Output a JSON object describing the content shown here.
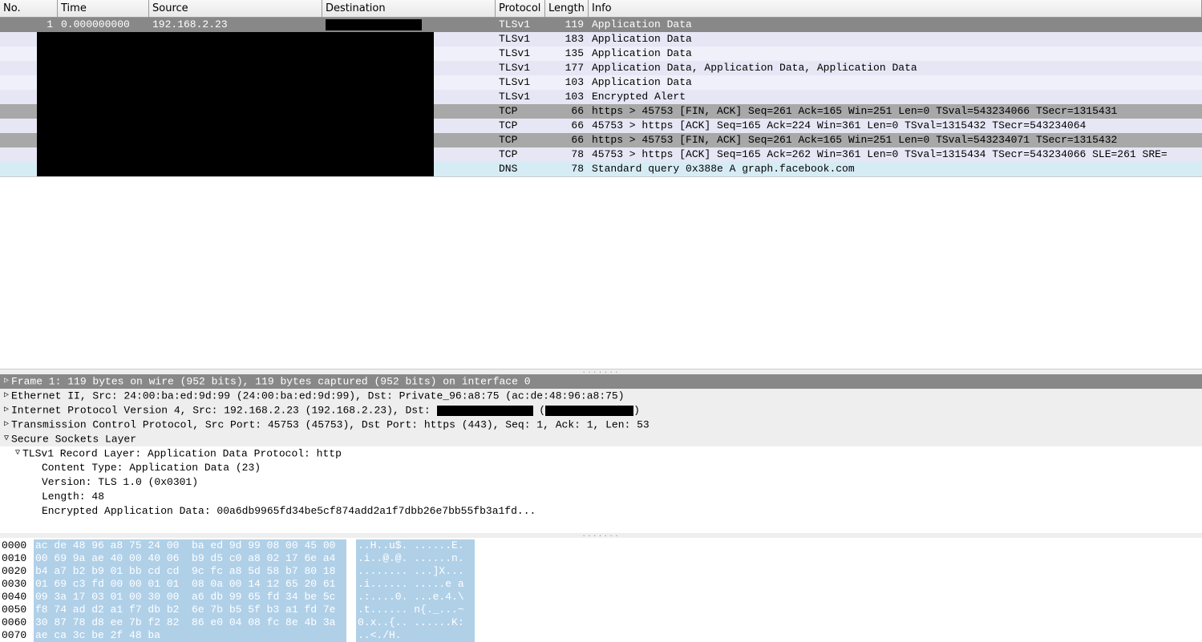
{
  "columns": {
    "no": "No.",
    "time": "Time",
    "src": "Source",
    "dst": "Destination",
    "proto": "Protocol",
    "len": "Length",
    "info": "Info"
  },
  "packets": [
    {
      "no": "1",
      "time": "0.000000000",
      "src": "192.168.2.23",
      "dst": "",
      "proto": "TLSv1",
      "len": "119",
      "info": "Application Data",
      "cls": "row-selected",
      "dstRedacted": true
    },
    {
      "no": "",
      "time": "",
      "src": "",
      "dst": "",
      "proto": "TLSv1",
      "len": "183",
      "info": "Application Data",
      "cls": "row-tls-odd"
    },
    {
      "no": "",
      "time": "",
      "src": "",
      "dst": "",
      "proto": "TLSv1",
      "len": "135",
      "info": "Application Data",
      "cls": "row-tls-even"
    },
    {
      "no": "",
      "time": "",
      "src": "",
      "dst": "",
      "proto": "TLSv1",
      "len": "177",
      "info": "Application Data, Application Data, Application Data",
      "cls": "row-tls-odd"
    },
    {
      "no": "",
      "time": "",
      "src": "",
      "dst": "",
      "proto": "TLSv1",
      "len": "103",
      "info": "Application Data",
      "cls": "row-tls-even"
    },
    {
      "no": "",
      "time": "",
      "src": "",
      "dst": "",
      "proto": "TLSv1",
      "len": "103",
      "info": "Encrypted Alert",
      "cls": "row-tls-odd"
    },
    {
      "no": "",
      "time": "",
      "src": "",
      "dst": "",
      "proto": "TCP",
      "len": "66",
      "info": "https > 45753 [FIN, ACK] Seq=261 Ack=165 Win=251 Len=0 TSval=543234066 TSecr=1315431",
      "cls": "row-tcp-gray"
    },
    {
      "no": "",
      "time": "",
      "src": "",
      "dst": "",
      "proto": "TCP",
      "len": "66",
      "info": "45753 > https [ACK] Seq=165 Ack=224 Win=361 Len=0 TSval=1315432 TSecr=543234064",
      "cls": "row-tcp-light"
    },
    {
      "no": "",
      "time": "",
      "src": "",
      "dst": "",
      "proto": "TCP",
      "len": "66",
      "info": "https > 45753 [FIN, ACK] Seq=261 Ack=165 Win=251 Len=0 TSval=543234071 TSecr=1315432",
      "cls": "row-tcp-gray"
    },
    {
      "no": "",
      "time": "",
      "src": "",
      "dst": "",
      "proto": "TCP",
      "len": "78",
      "info": "45753 > https [ACK] Seq=165 Ack=262 Win=361 Len=0 TSval=1315434 TSecr=543234066 SLE=261 SRE=",
      "cls": "row-tcp-light"
    },
    {
      "no": "",
      "time": "",
      "src": "",
      "dst": "",
      "proto": "DNS",
      "len": "78",
      "info": "Standard query 0x388e  A graph.facebook.com",
      "cls": "row-dns"
    }
  ],
  "details": {
    "frame": "Frame 1: 119 bytes on wire (952 bits), 119 bytes captured (952 bits) on interface 0",
    "eth": "Ethernet II, Src: 24:00:ba:ed:9d:99 (24:00:ba:ed:9d:99), Dst: Private_96:a8:75 (ac:de:48:96:a8:75)",
    "ip_a": "Internet Protocol Version 4, Src: 192.168.2.23 (192.168.2.23), Dst: ",
    "ip_b": " (",
    "ip_c": ")",
    "tcp": "Transmission Control Protocol, Src Port: 45753 (45753), Dst Port: https (443), Seq: 1, Ack: 1, Len: 53",
    "ssl": "Secure Sockets Layer",
    "tlsrec": "TLSv1 Record Layer: Application Data Protocol: http",
    "ctype": "Content Type: Application Data (23)",
    "ver": "Version: TLS 1.0 (0x0301)",
    "lenf": "Length: 48",
    "encd": "Encrypted Application Data: 00a6db9965fd34be5cf874add2a1f7dbb26e7bb55fb3a1fd..."
  },
  "hex": [
    {
      "off": "0000",
      "b": "ac de 48 96 a8 75 24 00  ba ed 9d 99 08 00 45 00",
      "a": "..H..u$. ......E."
    },
    {
      "off": "0010",
      "b": "00 69 9a ae 40 00 40 06  b9 d5 c0 a8 02 17 6e a4",
      "a": ".i..@.@. ......n."
    },
    {
      "off": "0020",
      "b": "b4 a7 b2 b9 01 bb cd cd  9c fc a8 5d 58 b7 80 18",
      "a": "........ ...]X..."
    },
    {
      "off": "0030",
      "b": "01 69 c3 fd 00 00 01 01  08 0a 00 14 12 65 20 61",
      "a": ".i...... .....e a"
    },
    {
      "off": "0040",
      "b": "09 3a 17 03 01 00 30 00  a6 db 99 65 fd 34 be 5c",
      "a": ".:....0. ...e.4.\\"
    },
    {
      "off": "0050",
      "b": "f8 74 ad d2 a1 f7 db b2  6e 7b b5 5f b3 a1 fd 7e",
      "a": ".t...... n{._...~"
    },
    {
      "off": "0060",
      "b": "30 87 78 d8 ee 7b f2 82  86 e0 04 08 fc 8e 4b 3a",
      "a": "0.x..{.. ......K:"
    },
    {
      "off": "0070",
      "b": "ae ca 3c be 2f 48 ba                            ",
      "a": "..<./H.         "
    }
  ]
}
